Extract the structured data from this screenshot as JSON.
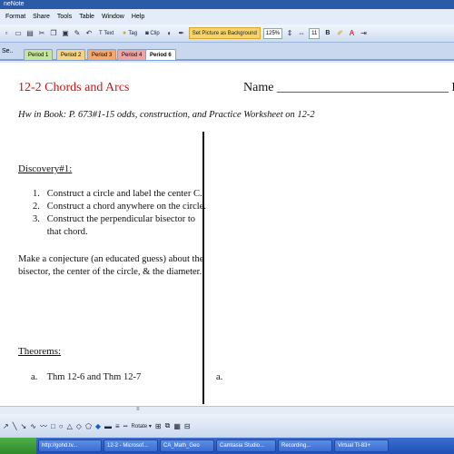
{
  "window": {
    "title": "neNote"
  },
  "menu": [
    "Format",
    "Share",
    "Tools",
    "Table",
    "Window",
    "Help"
  ],
  "toolbar": {
    "text_label": "Text",
    "tag_label": "Tag",
    "clip_label": "Clip",
    "set_bg_label": "Set Picture as Background",
    "zoom": "125%",
    "font_size": "11",
    "bold": "B"
  },
  "tabs": {
    "nav_left": "Se..",
    "items": [
      "Period 1",
      "Period 2",
      "Period 3",
      "Period 4",
      "Period 6"
    ],
    "colors": [
      "#c7e39c",
      "#f5d585",
      "#f6a86c",
      "#f0a3a3",
      "#ffffff"
    ]
  },
  "page": {
    "title": "12-2  Chords and Arcs",
    "name_label": "Name ___________________________  P.  ___",
    "homework": "Hw in Book:  P. 673#1-15 odds, construction, and Practice Worksheet on 12-2",
    "discovery_heading": "Discovery#1:",
    "steps": [
      "1.   Construct a circle and label the center C.",
      "2.   Construct a chord anywhere on the circle.",
      "3.   Construct the perpendicular bisector to",
      "      that chord."
    ],
    "conjecture": [
      "Make a conjecture (an educated guess) about the",
      "bisector, the center of the circle, & the diameter."
    ],
    "theorems_heading": "Theorems:",
    "theorem_a_left": "a.    Thm 12-6 and Thm 12-7",
    "theorem_a_right": "a."
  },
  "drawing_toolbar": {
    "rotate_label": "Rotate"
  },
  "taskbar": {
    "items": [
      "http://gohd.tv...",
      "12-2 - Microsof...",
      "CA_Math_Geo",
      "Camtasia Studio...",
      "Recording...",
      "Virtual TI-83+"
    ]
  }
}
